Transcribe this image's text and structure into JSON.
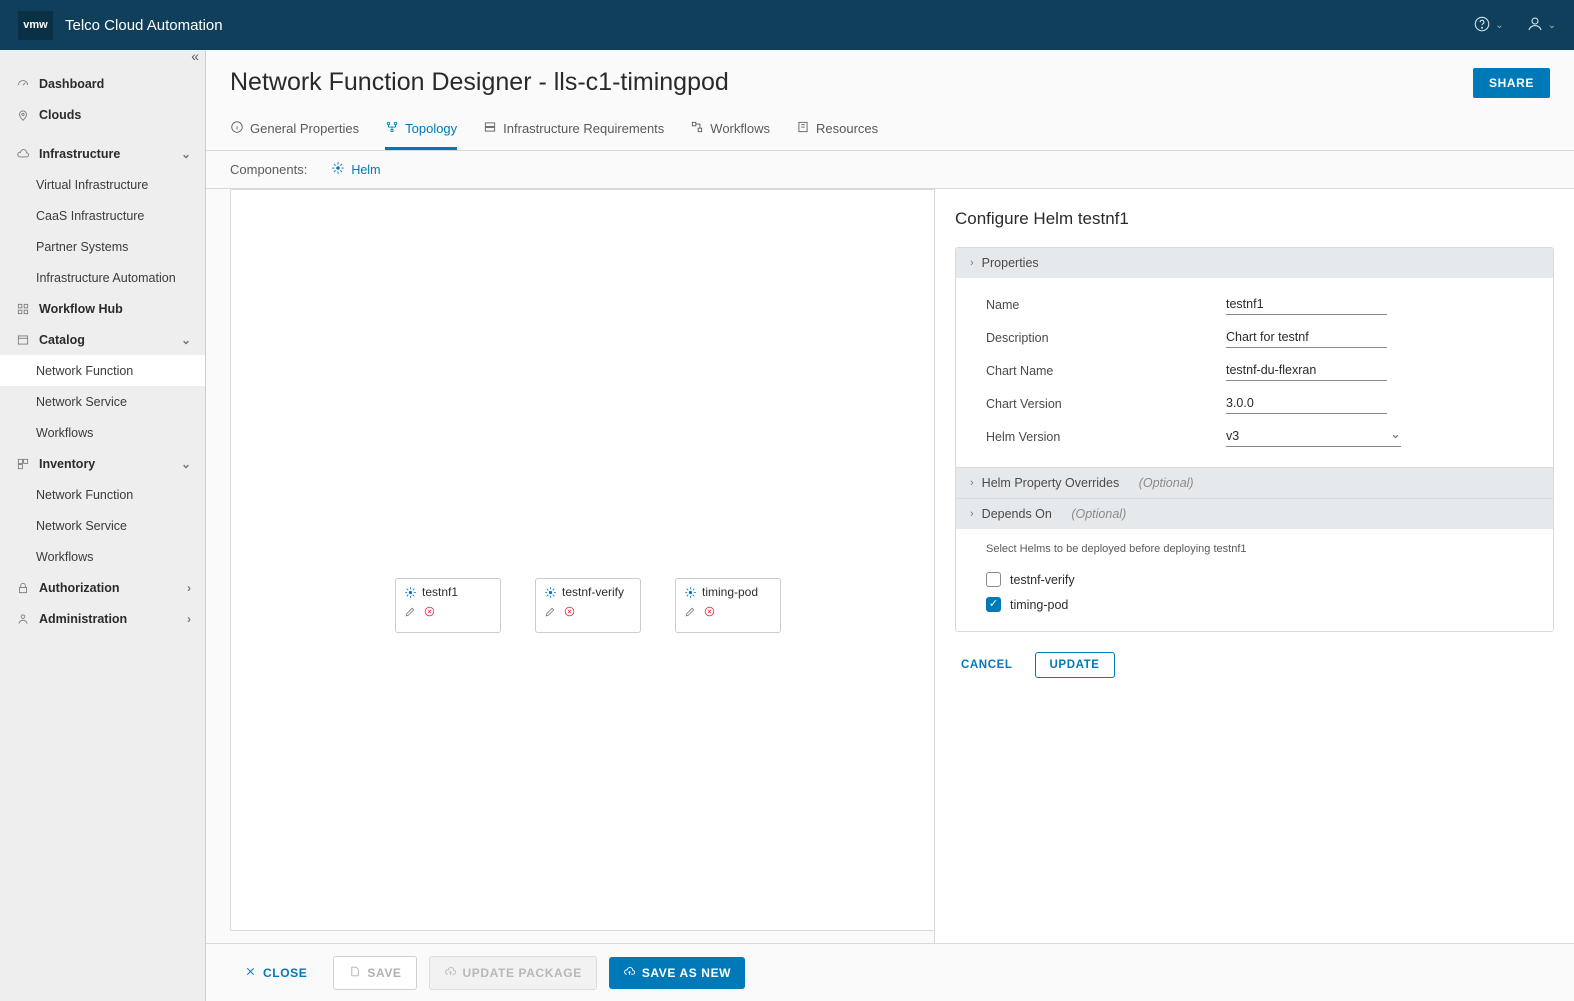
{
  "brand": "Telco Cloud Automation",
  "sidebar": {
    "items": [
      {
        "label": "Dashboard",
        "icon": "gauge",
        "bold": true
      },
      {
        "label": "Clouds",
        "icon": "pin",
        "bold": true
      }
    ],
    "infra": {
      "label": "Infrastructure",
      "items": [
        {
          "label": "Virtual Infrastructure"
        },
        {
          "label": "CaaS Infrastructure"
        },
        {
          "label": "Partner Systems"
        },
        {
          "label": "Infrastructure Automation"
        }
      ]
    },
    "workflowhub": {
      "label": "Workflow Hub"
    },
    "catalog": {
      "label": "Catalog",
      "items": [
        {
          "label": "Network Function",
          "active": true
        },
        {
          "label": "Network Service"
        },
        {
          "label": "Workflows"
        }
      ]
    },
    "inventory": {
      "label": "Inventory",
      "items": [
        {
          "label": "Network Function"
        },
        {
          "label": "Network Service"
        },
        {
          "label": "Workflows"
        }
      ]
    },
    "authorization": {
      "label": "Authorization"
    },
    "administration": {
      "label": "Administration"
    }
  },
  "page": {
    "title": "Network Function Designer - lls-c1-timingpod",
    "share": "SHARE"
  },
  "tabs": [
    {
      "label": "General Properties"
    },
    {
      "label": "Topology",
      "active": true
    },
    {
      "label": "Infrastructure Requirements"
    },
    {
      "label": "Workflows"
    },
    {
      "label": "Resources"
    }
  ],
  "components": {
    "label": "Components:",
    "helm": "Helm"
  },
  "nodes": [
    {
      "label": "testnf1"
    },
    {
      "label": "testnf-verify"
    },
    {
      "label": "timing-pod"
    }
  ],
  "config": {
    "title": "Configure Helm testnf1",
    "sections": {
      "properties": "Properties",
      "overrides": "Helm Property Overrides",
      "depends": "Depends On",
      "optional": "(Optional)"
    },
    "form": {
      "name": {
        "label": "Name",
        "value": "testnf1"
      },
      "description": {
        "label": "Description",
        "value": "Chart for testnf"
      },
      "chartName": {
        "label": "Chart Name",
        "value": "testnf-du-flexran"
      },
      "chartVersion": {
        "label": "Chart Version",
        "value": "3.0.0"
      },
      "helmVersion": {
        "label": "Helm Version",
        "value": "v3"
      }
    },
    "depends": {
      "hint": "Select Helms to be deployed before deploying testnf1",
      "options": [
        {
          "label": "testnf-verify",
          "checked": false
        },
        {
          "label": "timing-pod",
          "checked": true
        }
      ]
    },
    "actions": {
      "cancel": "CANCEL",
      "update": "UPDATE"
    }
  },
  "footer": {
    "close": "CLOSE",
    "save": "SAVE",
    "updatePkg": "UPDATE PACKAGE",
    "saveAsNew": "SAVE AS NEW"
  }
}
